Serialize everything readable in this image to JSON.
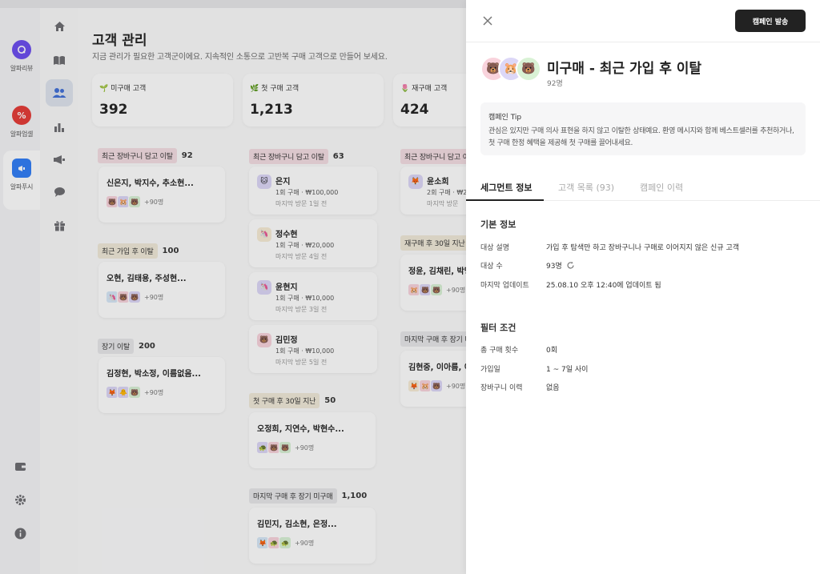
{
  "colors": {
    "primary_dark": "#222222",
    "active_nav": "#dfe4ee",
    "tag_pink": "#f4dde3",
    "tag_beige": "#f1ead9",
    "tag_gray": "#e8e8ea"
  },
  "apps": [
    {
      "name": "알파리뷰",
      "icon": "review-chat-icon",
      "color": "#6a4cf0",
      "glyph": ""
    },
    {
      "name": "알파업셀",
      "icon": "percent-icon",
      "color": "#e53935",
      "glyph": "%"
    },
    {
      "name": "알파푸시",
      "icon": "megaphone-icon",
      "color": "#2f7df6",
      "glyph": ""
    }
  ],
  "main": {
    "title": "고객 관리",
    "subtitle": "지금 관리가 필요한 고객군이에요. 지속적인 소통으로 고반복 구매 고객으로 만들어 보세요.",
    "stats": [
      {
        "label": "🌱 미구매 고객",
        "value": "392"
      },
      {
        "label": "🌿 첫 구매 고객",
        "value": "1,213"
      },
      {
        "label": "🌷 재구매 고객",
        "value": "424"
      }
    ],
    "col1": [
      {
        "tag": "최근 장바구니 담고 이탈",
        "count": "92",
        "names": "신은지, 박지수, 추소현...",
        "more": "+90명",
        "avatars": [
          "🐻",
          "🐹",
          "🐻"
        ]
      },
      {
        "tag": "최근 가입 후 이탈",
        "count": "100",
        "names": "오현, 김태용, 주성현...",
        "more": "+90명",
        "avatars": [
          "🦄",
          "🐻",
          "🐻"
        ]
      },
      {
        "tag": "장기 이탈",
        "count": "200",
        "names": "김정현, 박소정, 이름없음...",
        "more": "+90명",
        "avatars": [
          "🦊",
          "🐥",
          "🐻"
        ]
      }
    ],
    "col2": {
      "tag1": "최근 장바구니 담고 이탈",
      "count1": "63",
      "persons": [
        {
          "name": "은지",
          "line1": "1회 구매 · ₩100,000",
          "line2": "마지막 방문 1일 전",
          "avatar": "🐱"
        },
        {
          "name": "정수현",
          "line1": "1회 구매 · ₩20,000",
          "line2": "마지막 방문 4일 전",
          "avatar": "🦄"
        },
        {
          "name": "윤현지",
          "line1": "1회 구매 · ₩10,000",
          "line2": "마지막 방문 3일 전",
          "avatar": "🦄"
        },
        {
          "name": "김민정",
          "line1": "1회 구매 · ₩10,000",
          "line2": "마지막 방문 5일 전",
          "avatar": "🐻"
        }
      ],
      "groups": [
        {
          "tag": "첫 구매 후 30일 지난",
          "count": "50",
          "names": "오정희, 지연수, 박현수...",
          "more": "+90명",
          "avatars": [
            "🐢",
            "🐻",
            "🐻"
          ]
        },
        {
          "tag": "마지막 구매 후 장기 미구매",
          "count": "1,100",
          "names": "김민지, 김소현, 은정...",
          "more": "+90명",
          "avatars": [
            "🦊",
            "🐢",
            "🐢"
          ]
        }
      ]
    },
    "col3": {
      "tag1": "최근 장바구니 담고 이탈",
      "person": {
        "name": "윤소희",
        "line1": "2회 구매 · ₩2",
        "line2": "마지막 방문",
        "avatar": "🦊"
      },
      "groups": [
        {
          "tag": "재구매 후 30일 지난",
          "names": "정윤, 김채린, 박명화",
          "more": "+90명",
          "avatars": [
            "🐹",
            "🐻",
            "🐻"
          ]
        },
        {
          "tag": "마지막 구매 후 장기 미",
          "names": "김현중, 이아름, 이주",
          "more": "+90명",
          "avatars": [
            "🦊",
            "🐹",
            "🐻"
          ]
        }
      ]
    }
  },
  "panel": {
    "send_label": "캠페인 발송",
    "segment_title": "미구매 - 최근 가입 후 이탈",
    "segment_count": "92명",
    "segment_avatars": [
      "🐻",
      "🐹",
      "🐻"
    ],
    "tip_title": "캠페인 Tip",
    "tip_body": "관심은 있지만 구매 의사 표현을 하지 않고 이탈한 상태예요. 환영 메시지와 함께 베스트셀러를 추천하거나, 첫 구매 한정 혜택을 제공해 첫 구매를 끌어내세요.",
    "tabs": [
      "세그먼트 정보",
      "고객 목록 (93)",
      "캠페인 이력"
    ],
    "basic_title": "기본 정보",
    "basic": [
      {
        "label": "대상 설명",
        "value": "가입 후 탐색만 하고 장바구니나 구매로 이어지지 않은 신규 고객"
      },
      {
        "label": "대상 수",
        "value": "93명"
      },
      {
        "label": "마지막 업데이트",
        "value": "25.08.10 오후 12:40에 업데이트 됨"
      }
    ],
    "filter_title": "필터 조건",
    "filters": [
      {
        "label": "총 구매 횟수",
        "value": "0회"
      },
      {
        "label": "가입일",
        "value": "1 ~ 7일 사이"
      },
      {
        "label": "장바구니 이력",
        "value": "없음"
      }
    ]
  }
}
